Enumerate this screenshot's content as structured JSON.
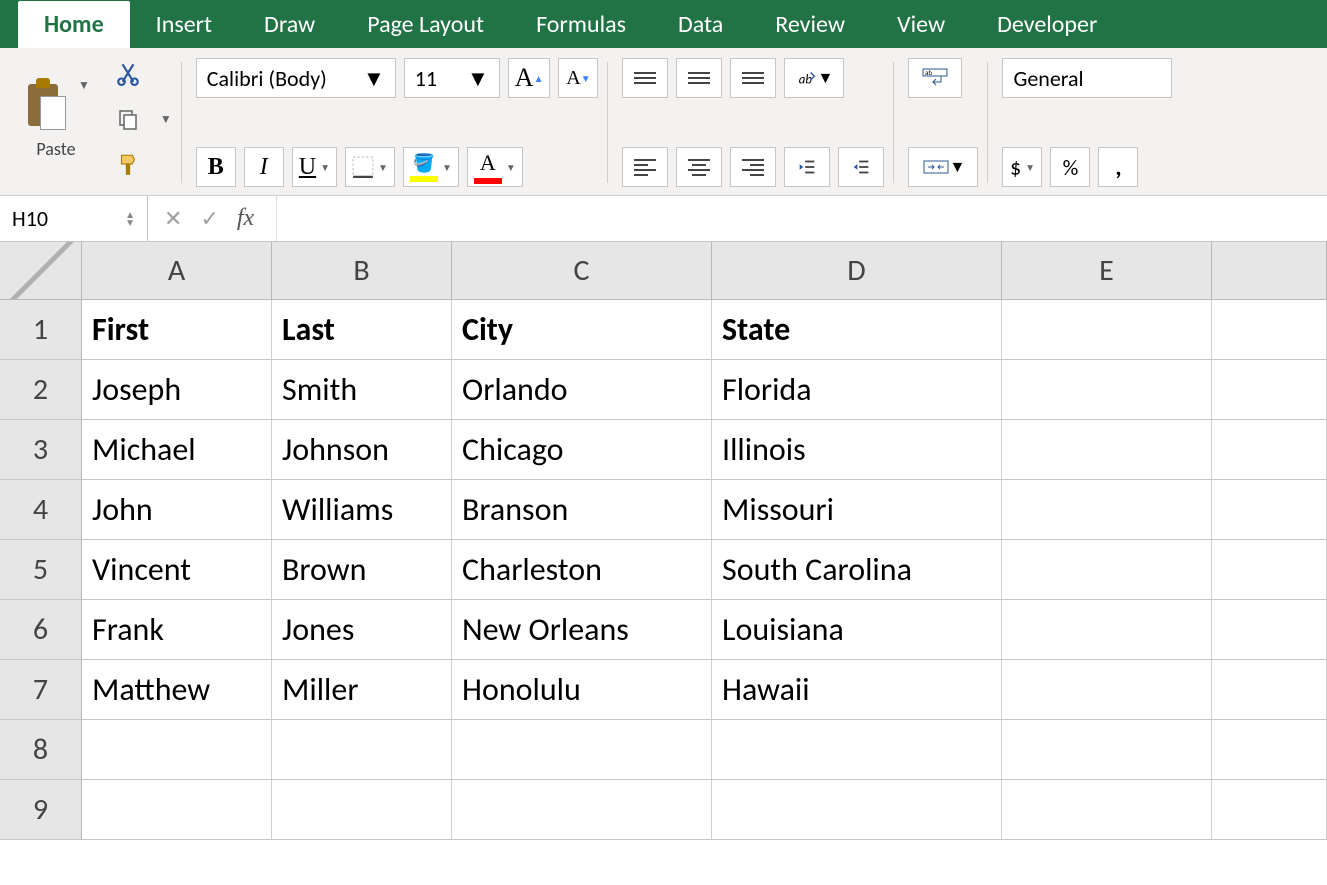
{
  "tabs": {
    "active": "Home",
    "items": [
      "Home",
      "Insert",
      "Draw",
      "Page Layout",
      "Formulas",
      "Data",
      "Review",
      "View",
      "Developer"
    ]
  },
  "ribbon": {
    "paste_label": "Paste",
    "font_name": "Calibri (Body)",
    "font_size": "11",
    "number_format": "General"
  },
  "namebox": "H10",
  "formula": "",
  "columns": [
    "A",
    "B",
    "C",
    "D",
    "E"
  ],
  "row_numbers": [
    "1",
    "2",
    "3",
    "4",
    "5",
    "6",
    "7",
    "8",
    "9"
  ],
  "headers": {
    "A": "First",
    "B": "Last",
    "C": "City",
    "D": "State"
  },
  "rows": [
    {
      "A": "Joseph",
      "B": "Smith",
      "C": "Orlando",
      "D": "Florida"
    },
    {
      "A": "Michael",
      "B": "Johnson",
      "C": "Chicago",
      "D": "Illinois"
    },
    {
      "A": "John",
      "B": "Williams",
      "C": "Branson",
      "D": "Missouri"
    },
    {
      "A": "Vincent",
      "B": "Brown",
      "C": "Charleston",
      "D": "South Carolina"
    },
    {
      "A": "Frank",
      "B": "Jones",
      "C": "New Orleans",
      "D": "Louisiana"
    },
    {
      "A": "Matthew",
      "B": "Miller",
      "C": "Honolulu",
      "D": "Hawaii"
    }
  ]
}
